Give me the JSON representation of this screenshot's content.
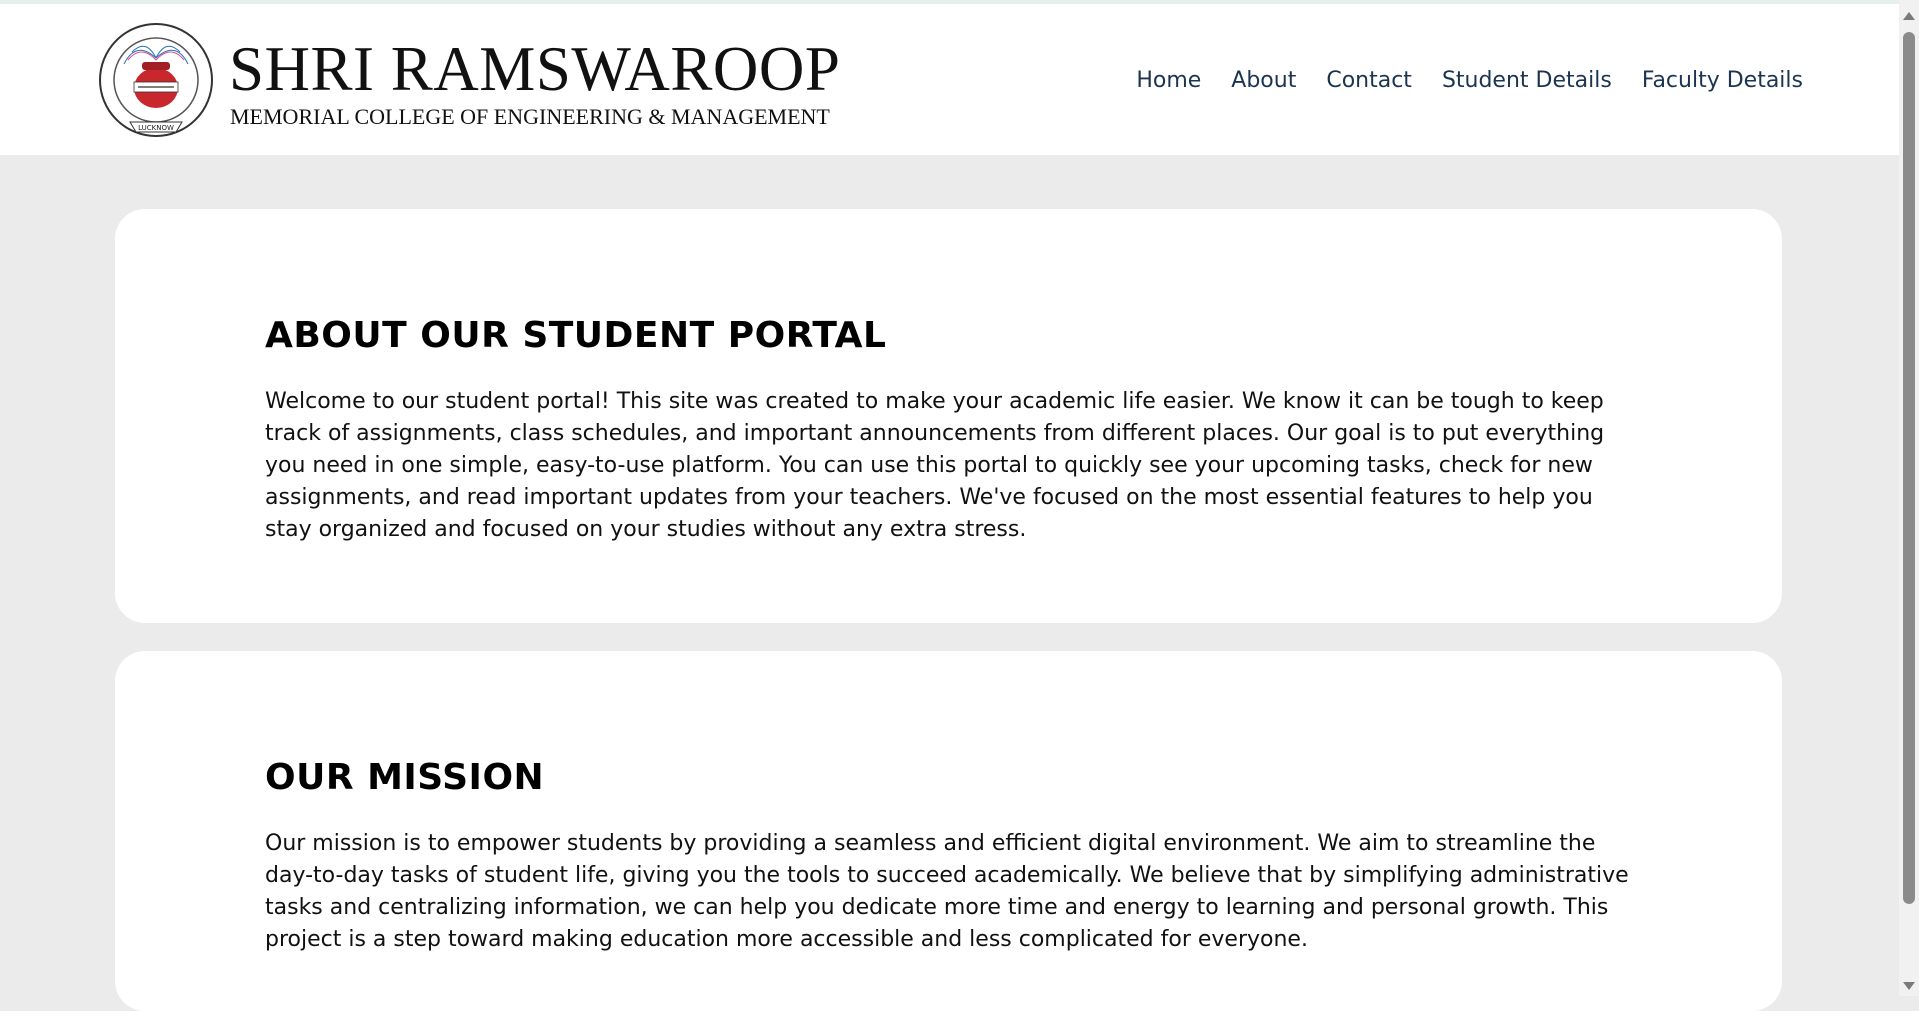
{
  "header": {
    "title": "SHRI RAMSWAROOP",
    "subtitle": "MEMORIAL COLLEGE OF ENGINEERING & MANAGEMENT",
    "logo": {
      "ring_text": "SHRI RAMSWAROOP MEMORIAL COLLEGE OF ENGINEERING & MANAGEMENT",
      "bottom_text": "LUCKNOW",
      "banner_text": "विद्यया अमृतमश्नुते"
    }
  },
  "nav": {
    "items": [
      "Home",
      "About",
      "Contact",
      "Student Details",
      "Faculty Details"
    ]
  },
  "sections": [
    {
      "heading": "ABOUT OUR STUDENT PORTAL",
      "body": "Welcome to our student portal! This site was created to make your academic life easier. We know it can be tough to keep track of assignments, class schedules, and important announcements from different places. Our goal is to put everything you need in one simple, easy-to-use platform. You can use this portal to quickly see your upcoming tasks, check for new assignments, and read important updates from your teachers. We've focused on the most essential features to help you stay organized and focused on your studies without any extra stress."
    },
    {
      "heading": "OUR MISSION",
      "body": "Our mission is to empower students by providing a seamless and efficient digital environment. We aim to streamline the day-to-day tasks of student life, giving you the tools to succeed academically. We believe that by simplifying administrative tasks and centralizing information, we can help you dedicate more time and energy to learning and personal growth. This project is a step toward making education more accessible and less complicated for everyone."
    }
  ],
  "colors": {
    "nav_text": "#1b3550",
    "page_bg": "#ebebeb",
    "card_bg": "#ffffff",
    "logo_red": "#c8282d"
  }
}
